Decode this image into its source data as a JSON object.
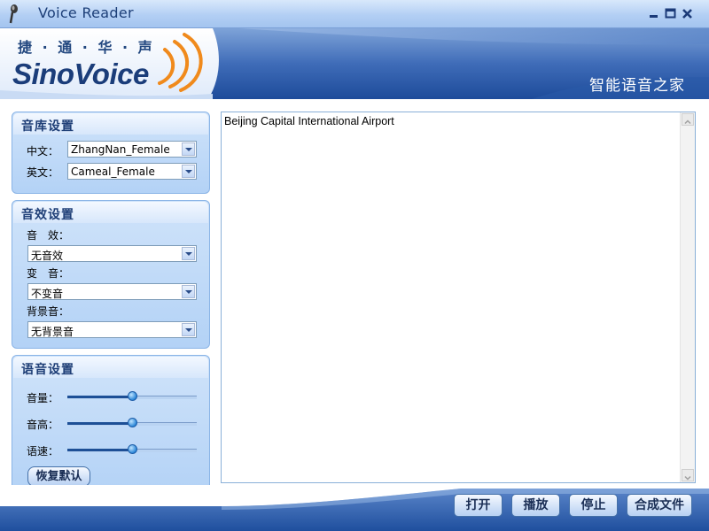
{
  "window": {
    "title": "Voice Reader"
  },
  "banner": {
    "logo_cn": "捷 · 通 · 华 · 声",
    "logo_en": "SinoVoice",
    "slogan": "智能语音之家"
  },
  "voice_library": {
    "title": "音库设置",
    "chinese_label": "中文：",
    "chinese_value": "ZhangNan_Female",
    "english_label": "英文：",
    "english_value": "Cameal_Female"
  },
  "sound_effects": {
    "title": "音效设置",
    "effect_label": "音　效：",
    "effect_value": "无音效",
    "pitch_shift_label": "变　音：",
    "pitch_shift_value": "不变音",
    "background_label": "背景音：",
    "background_value": "无背景音"
  },
  "voice_settings": {
    "title": "语音设置",
    "volume_label": "音量：",
    "volume_level": 0.5,
    "pitch_label": "音高：",
    "pitch_level": 0.5,
    "speed_label": "语速：",
    "speed_level": 0.5,
    "reset_label": "恢复默认"
  },
  "editor": {
    "text": "Beijing Capital International Airport"
  },
  "actions": {
    "open": "打开",
    "play": "播放",
    "stop": "停止",
    "synthesize": "合成文件"
  },
  "colors": {
    "accent": "#1f3f77",
    "brand_orange": "#f08a1c",
    "banner_blue": "#2d5aa8"
  }
}
